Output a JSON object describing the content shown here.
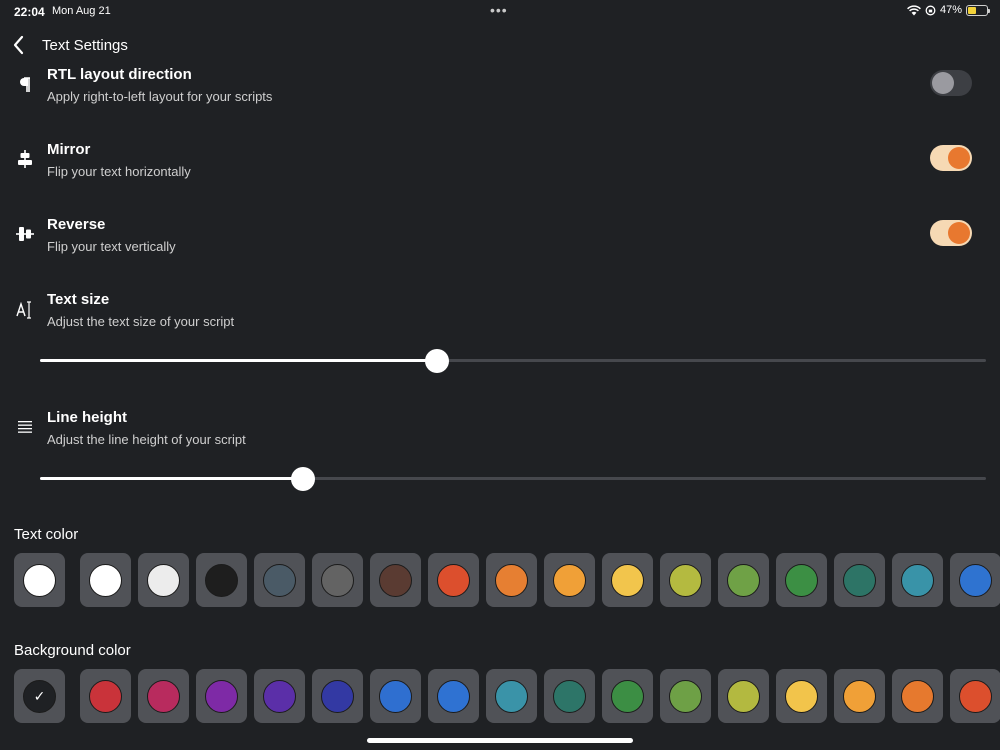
{
  "status": {
    "time": "22:04",
    "date": "Mon Aug 21",
    "battery": "47%",
    "battery_level": 0.47,
    "dots": "•••"
  },
  "nav": {
    "title": "Text Settings"
  },
  "settings": {
    "rtl": {
      "title": "RTL layout direction",
      "subtitle": "Apply right-to-left layout for your scripts",
      "icon": "pilcrow-icon",
      "enabled": false
    },
    "mirror": {
      "title": "Mirror",
      "subtitle": "Flip your text horizontally",
      "icon": "mirror-icon",
      "enabled": true
    },
    "reverse": {
      "title": "Reverse",
      "subtitle": "Flip your text vertically",
      "icon": "reverse-icon",
      "enabled": true
    },
    "text_size": {
      "title": "Text size",
      "subtitle": "Adjust the text size of your script",
      "icon": "text-size-icon",
      "value": 0.42
    },
    "line_height": {
      "title": "Line height",
      "subtitle": "Adjust the line height of your script",
      "icon": "line-height-icon",
      "value": 0.278
    }
  },
  "text_color": {
    "title": "Text color",
    "selected": "#ffffff",
    "options": [
      "#ffffff",
      "#ececec",
      "#1e1e1e",
      "#4a5a66",
      "#636363",
      "#5a3b32",
      "#dc4f2d",
      "#e67f32",
      "#f0a037",
      "#f2c54c",
      "#b4ba40",
      "#6fa146",
      "#3c8f44",
      "#2d7466",
      "#3993a8",
      "#2f73d0"
    ]
  },
  "background_color": {
    "title": "Background color",
    "selected": "#1f2124",
    "check": "✓",
    "options": [
      "#c9333a",
      "#b82b5e",
      "#7e2aa6",
      "#5b2fa8",
      "#3339a3",
      "#2f6fd0",
      "#2f72d2",
      "#3a93a8",
      "#2d7568",
      "#3c8e44",
      "#6ea046",
      "#b3b940",
      "#f2c44b",
      "#f0a037",
      "#e6792e",
      "#dc4f2d"
    ]
  },
  "accent": "#e8782f"
}
